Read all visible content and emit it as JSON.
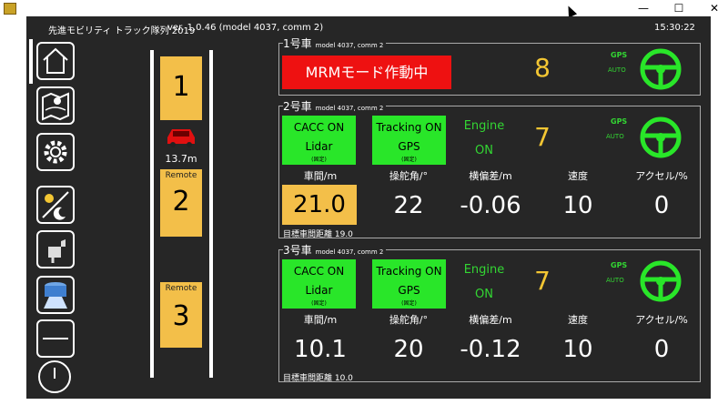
{
  "window": {
    "minimize": "—",
    "maximize": "☐",
    "close": "✕"
  },
  "header": {
    "title": "先進モビリティ トラック隊列 2019",
    "version": "ver. 1.0.46 (model 4037, comm 2)",
    "clock": "15:30:22"
  },
  "sidebar": {
    "icons": [
      "home-icon",
      "map-icon",
      "gear-icon",
      "day-night-icon",
      "camera-icon",
      "sensor-icon",
      "minus-icon",
      "power-icon"
    ]
  },
  "lane": {
    "positions": [
      {
        "number": "1",
        "remote": ""
      },
      {
        "number": "2",
        "remote": "Remote"
      },
      {
        "number": "3",
        "remote": "Remote"
      }
    ],
    "gap": "13.7m",
    "car_color": "#e01010"
  },
  "vehicles": [
    {
      "name": "1号車",
      "model": "model 4037, comm 2",
      "mrm": "MRMモード作動中",
      "count": "8",
      "gps": "GPS",
      "auto": "AUTO"
    },
    {
      "name": "2号車",
      "model": "model 4037, comm 2",
      "cacc": {
        "line1": "CACC ON",
        "line2": "Lidar",
        "line3": "(固定)"
      },
      "tracking": {
        "line1": "Tracking ON",
        "line2": "GPS",
        "line3": "(固定)"
      },
      "engine": {
        "label": "Engine",
        "state": "ON"
      },
      "count": "7",
      "gps": "GPS",
      "auto": "AUTO",
      "labels": [
        "車間/m",
        "操舵角/°",
        "横偏差/m",
        "速度",
        "アクセル/%"
      ],
      "values": [
        "21.0",
        "22",
        "-0.06",
        "10",
        "0"
      ],
      "target": "目標車間距離 19.0"
    },
    {
      "name": "3号車",
      "model": "model 4037, comm 2",
      "cacc": {
        "line1": "CACC ON",
        "line2": "Lidar",
        "line3": "(固定)"
      },
      "tracking": {
        "line1": "Tracking ON",
        "line2": "GPS",
        "line3": "(固定)"
      },
      "engine": {
        "label": "Engine",
        "state": "ON"
      },
      "count": "7",
      "gps": "GPS",
      "auto": "AUTO",
      "labels": [
        "車間/m",
        "操舵角/°",
        "横偏差/m",
        "速度",
        "アクセル/%"
      ],
      "values": [
        "10.1",
        "20",
        "-0.12",
        "10",
        "0"
      ],
      "target": "目標車間距離 10.0"
    }
  ],
  "colors": {
    "accent_green": "#29e629",
    "alert_red": "#ee1111",
    "position_yellow": "#f3bf49",
    "background": "#262626"
  }
}
